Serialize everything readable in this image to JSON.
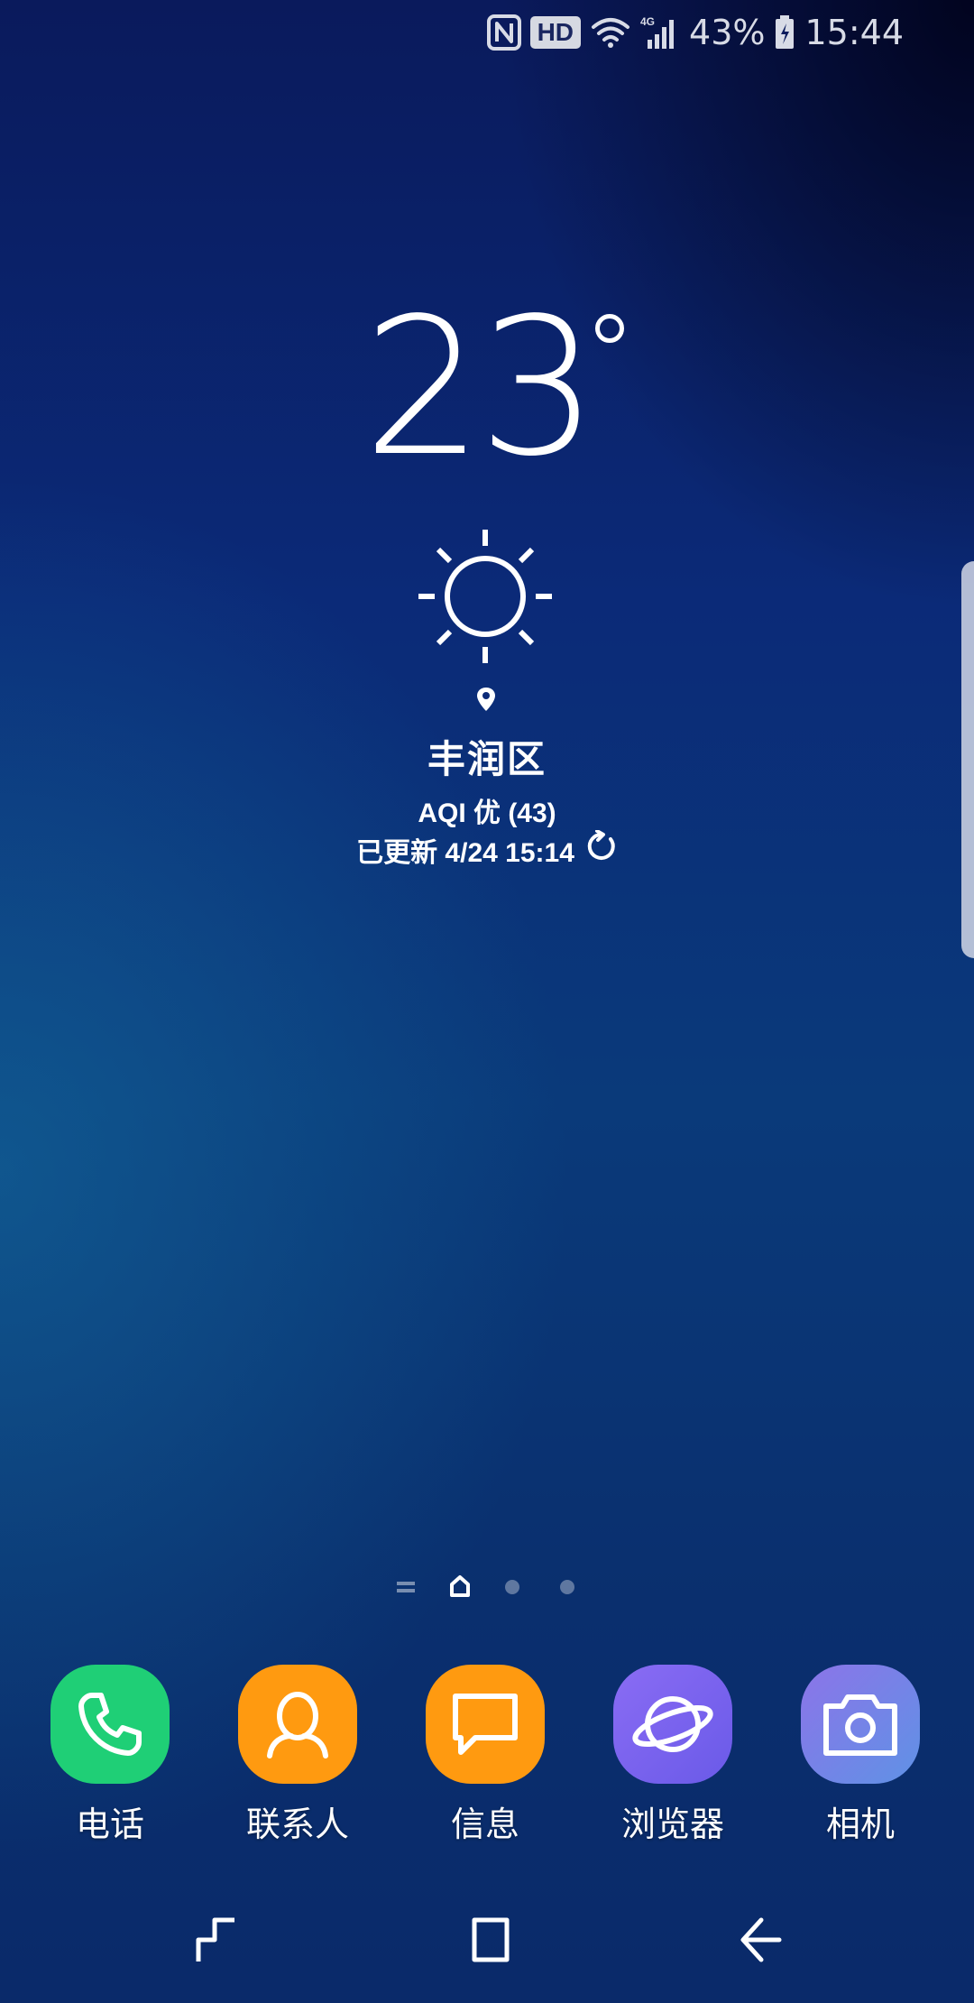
{
  "status_bar": {
    "icons": [
      "nfc-icon",
      "hd-icon",
      "wifi-icon",
      "signal-4g-icon",
      "battery-icon"
    ],
    "hd_label": "HD",
    "network_label": "4G",
    "battery_percent": "43%",
    "time": "15:44"
  },
  "weather": {
    "temperature": "23",
    "condition_icon": "sun-icon",
    "location": "丰润区",
    "aqi": "AQI 优 (43)",
    "updated": "已更新 4/24 15:14"
  },
  "page_indicator": {
    "pages": [
      "menu",
      "home",
      "page",
      "page"
    ],
    "active": "home"
  },
  "dock": {
    "apps": [
      {
        "label": "电话",
        "icon": "phone-icon",
        "color": "#1fcf76"
      },
      {
        "label": "联系人",
        "icon": "contacts-icon",
        "color": "#ff9a10"
      },
      {
        "label": "信息",
        "icon": "message-icon",
        "color": "#ff9a10"
      },
      {
        "label": "浏览器",
        "icon": "browser-icon",
        "color": "#7d63f0"
      },
      {
        "label": "相机",
        "icon": "camera-icon",
        "color": "#7c7ee8"
      }
    ]
  },
  "nav_bar": {
    "buttons": [
      "recents-icon",
      "home-icon",
      "back-icon"
    ]
  }
}
